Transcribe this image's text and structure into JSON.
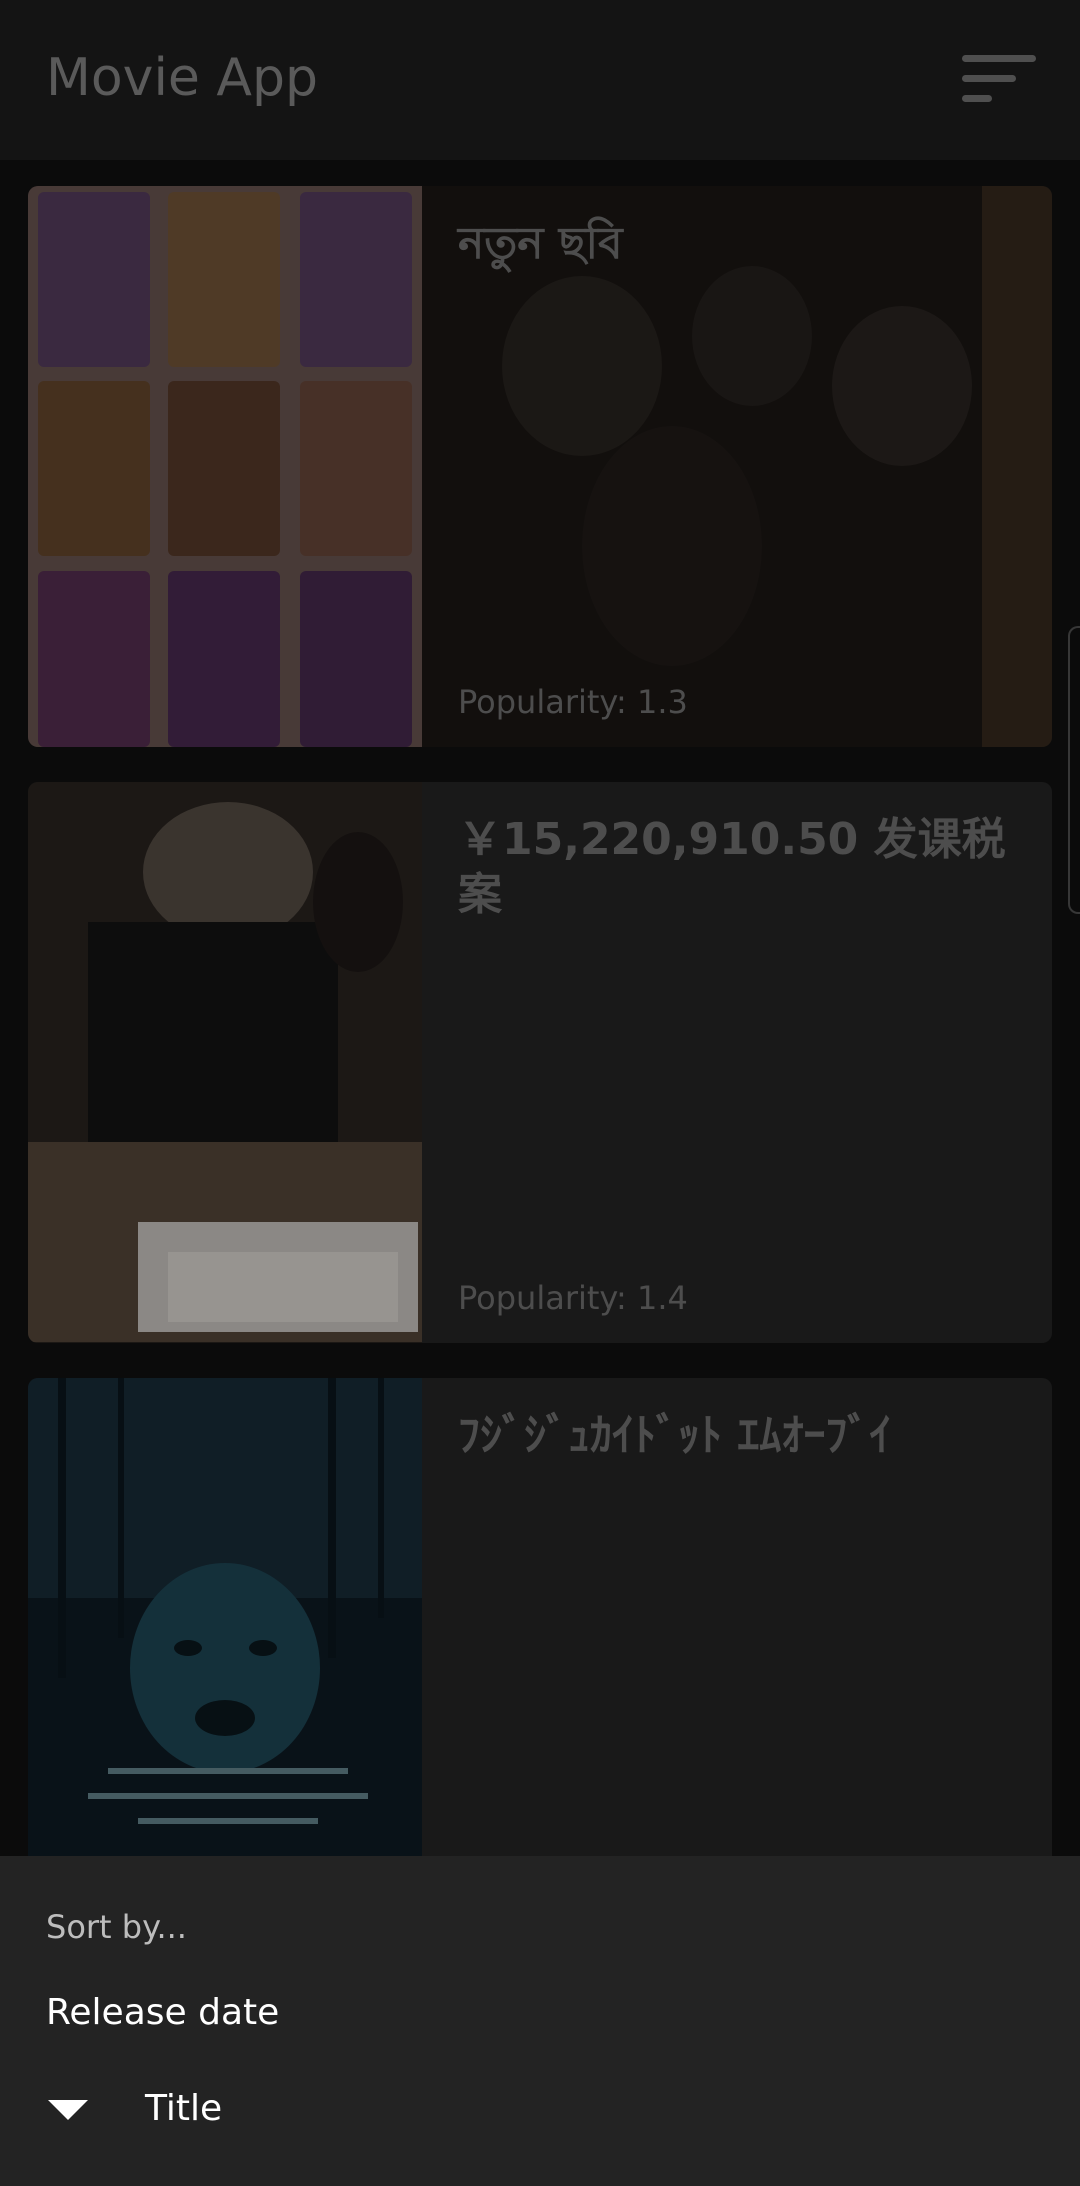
{
  "app": {
    "title": "Movie App"
  },
  "movies": [
    {
      "title": "নতুন ছবি",
      "popularity": "Popularity: 1.3"
    },
    {
      "title": "￥15,220,910.50 发课税案",
      "popularity": "Popularity: 1.4"
    },
    {
      "title": "ﾌｼﾞｼﾞｭｶｲﾄﾞｯﾄ ｴﾑｵｰﾌﾞｲ",
      "popularity": ""
    }
  ],
  "sort_sheet": {
    "heading": "Sort by...",
    "options": [
      "Release date",
      "Title"
    ]
  },
  "icons": {
    "sort": "sort-icon",
    "selected": "triangle-down-icon"
  }
}
